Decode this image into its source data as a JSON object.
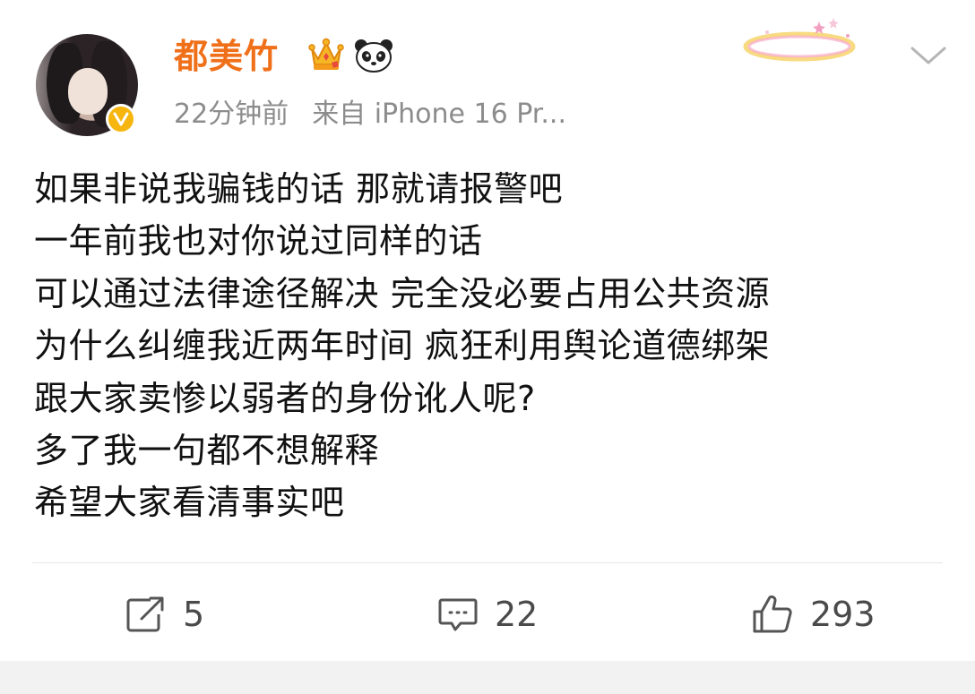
{
  "post": {
    "username": "都美竹",
    "time": "22分钟前",
    "source": "来自 iPhone 16 Pr...",
    "lines": [
      "如果非说我骗钱的话 那就请报警吧",
      "一年前我也对你说过同样的话",
      "可以通过法律途径解决 完全没必要占用公共资源",
      "为什么纠缠我近两年时间 疯狂利用舆论道德绑架",
      "跟大家卖惨以弱者的身份讹人呢?",
      "多了我一句都不想解释",
      "希望大家看清事实吧"
    ]
  },
  "actions": {
    "repost": "5",
    "comment": "22",
    "like": "293"
  },
  "icons": {
    "badge_crown": "crown-icon",
    "badge_panda": "panda-icon",
    "verified": "verified-icon",
    "menu": "chevron-down-icon",
    "repost": "share-icon",
    "comment": "comment-icon",
    "like": "thumbs-up-icon"
  },
  "colors": {
    "username": "#f0701a",
    "verified": "#f6b60f",
    "meta": "#8c8c8c",
    "count": "#4a4a4a"
  }
}
